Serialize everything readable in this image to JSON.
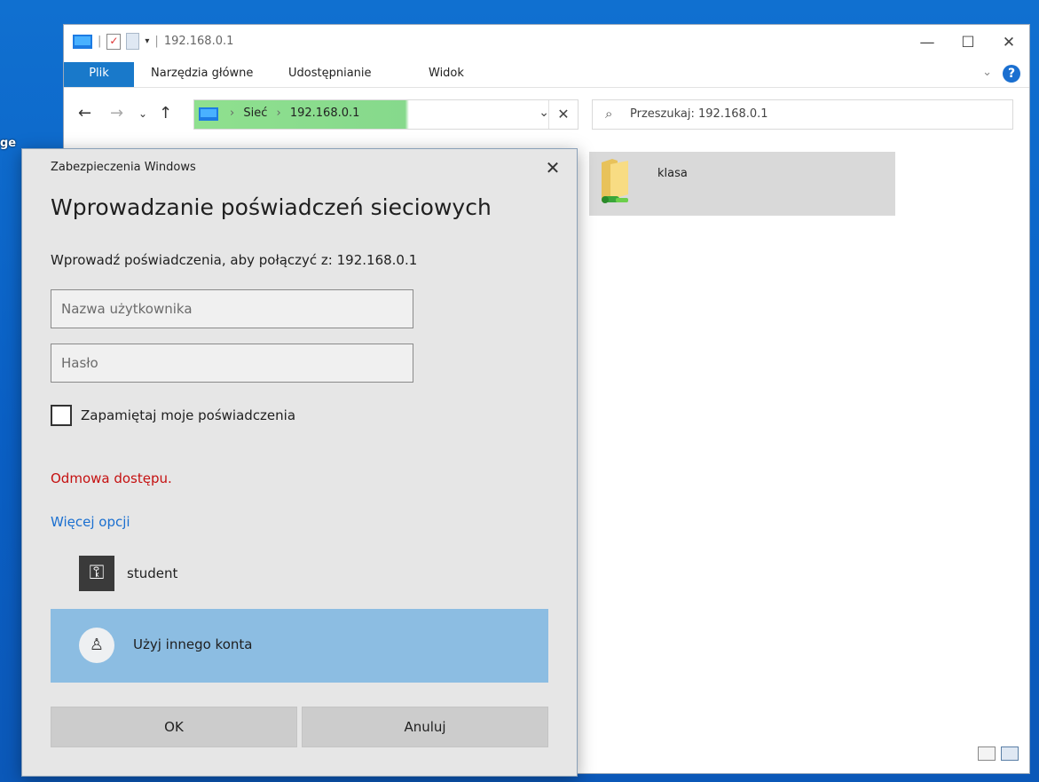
{
  "desktop": {
    "label": "ge"
  },
  "explorer": {
    "title": "192.168.0.1",
    "ribbon_tabs": [
      "Plik",
      "Narzędzia główne",
      "Udostępnianie",
      "Widok"
    ],
    "breadcrumbs": [
      "Sieć",
      "192.168.0.1"
    ],
    "search_placeholder": "Przeszukaj: 192.168.0.1",
    "items": [
      {
        "name": "klasa",
        "icon": "network-folder-icon"
      }
    ]
  },
  "dialog": {
    "caption": "Zabezpieczenia Windows",
    "title": "Wprowadzanie poświadczeń sieciowych",
    "message": "Wprowadź poświadczenia, aby połączyć z: 192.168.0.1",
    "username_placeholder": "Nazwa użytkownika",
    "username_value": "",
    "password_placeholder": "Hasło",
    "password_value": "",
    "remember_label": "Zapamiętaj moje poświadczenia",
    "remember_checked": false,
    "error": "Odmowa dostępu.",
    "more_options": "Więcej opcji",
    "accounts": [
      {
        "name": "student",
        "icon": "key-icon"
      },
      {
        "name": "Użyj innego konta",
        "icon": "user-icon",
        "selected": true
      }
    ],
    "ok_label": "OK",
    "cancel_label": "Anuluj"
  },
  "colors": {
    "accent": "#1979ca",
    "error": "#c51111",
    "link": "#1a6fd0",
    "selected_account": "#8cbde2",
    "address_highlight": "#8fe08f"
  }
}
